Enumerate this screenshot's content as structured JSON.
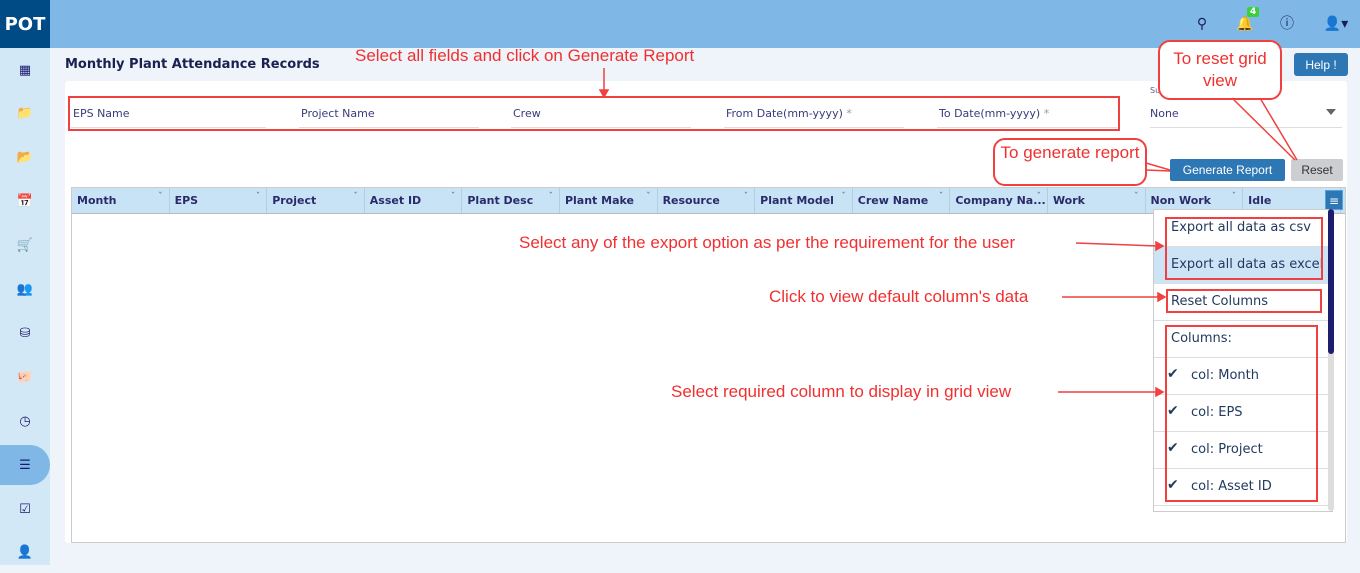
{
  "app": {
    "logo": "POT",
    "notification_count": "4"
  },
  "topbar_icons": [
    "search-icon",
    "bell-icon",
    "info-icon",
    "user-icon"
  ],
  "sidebar": {
    "items": [
      "building-icon",
      "folder-icon",
      "folder-open-icon",
      "calendar-icon",
      "cart-icon",
      "users-icon",
      "database-icon",
      "piggy-bank-icon",
      "dashboard-icon",
      "list-icon",
      "checkbox-icon",
      "user-icon"
    ],
    "active_index": 9
  },
  "page": {
    "title": "Monthly Plant Attendance Records",
    "help_label": "Help !"
  },
  "filters": {
    "eps": "EPS Name",
    "project": "Project Name",
    "crew": "Crew",
    "from": "From Date(mm-yyyy)",
    "to": "To Date(mm-yyyy)",
    "required_mark": "*"
  },
  "sub_reports": {
    "label": "Sub Reports",
    "value": "None"
  },
  "buttons": {
    "generate": "Generate Report",
    "reset": "Reset"
  },
  "grid": {
    "columns": [
      "Month",
      "EPS",
      "Project",
      "Asset ID",
      "Plant Desc",
      "Plant Make",
      "Resource",
      "Plant Model",
      "Crew Name",
      "Company Na...",
      "Work",
      "Non Work",
      "Idle"
    ]
  },
  "menu": {
    "export_csv": "Export all data as csv",
    "export_excel": "Export all data as excel",
    "reset_columns": "Reset Columns",
    "columns_label": "Columns:",
    "columns": [
      "col: Month",
      "col: EPS",
      "col: Project",
      "col: Asset ID"
    ]
  },
  "annotations": {
    "fields": "Select all fields and click on Generate Report",
    "reset_grid": "To reset grid view",
    "generate": "To generate report",
    "export": "Select any of the export option as per the requirement for the user",
    "reset_cols": "Click to view default column's data",
    "select_cols": "Select required column to display in grid view"
  },
  "colors": {
    "topbar": "#7fb8e6",
    "logo": "#004a85",
    "primary_button": "#2e77b5",
    "annotation": "#f03030"
  }
}
